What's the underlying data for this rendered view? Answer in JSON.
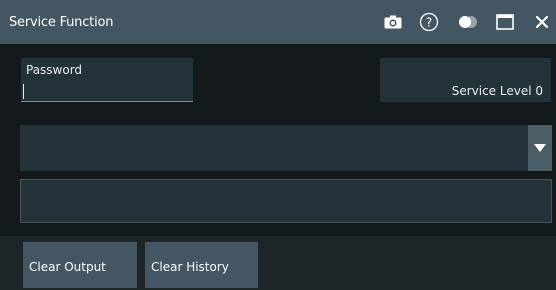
{
  "window": {
    "title": "Service Function",
    "toolbar_icons": [
      "camera-icon",
      "help-icon",
      "toggle-icon",
      "maximize-icon",
      "close-icon"
    ]
  },
  "password": {
    "label": "Password",
    "value": ""
  },
  "service_level": {
    "text": "Service Level 0"
  },
  "function_select": {
    "selected": ""
  },
  "output": {
    "text": ""
  },
  "buttons": {
    "clear_output": "Clear Output",
    "clear_history": "Clear History"
  },
  "colors": {
    "title_bar": "#435661",
    "background": "#101314",
    "field": "#243239",
    "accent": "#3d9be9",
    "button": "#435661"
  }
}
